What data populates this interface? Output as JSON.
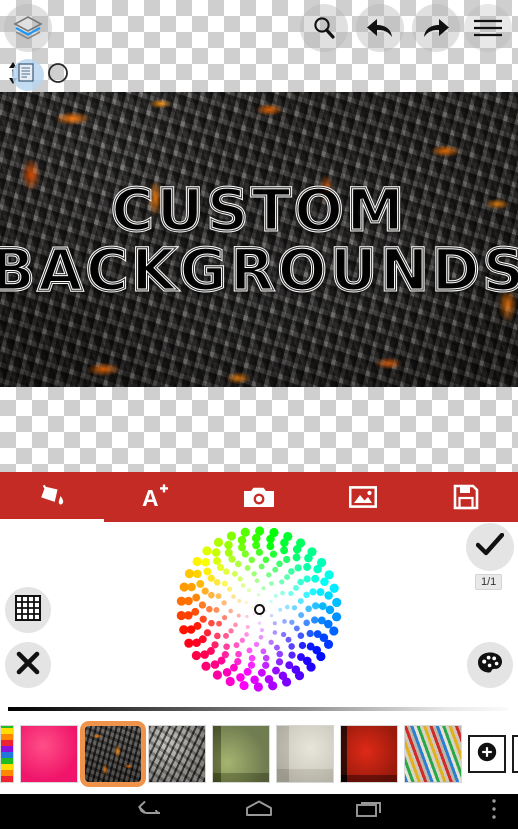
{
  "app": {
    "artwork_line_1": "CUSTOM",
    "artwork_line_2": "BACKGROUNDS"
  },
  "top_toolbar": {
    "items": [
      {
        "name": "layers-icon",
        "label": "Layers"
      },
      {
        "name": "search-icon",
        "label": "Zoom"
      },
      {
        "name": "undo-icon",
        "label": "Undo"
      },
      {
        "name": "redo-icon",
        "label": "Redo"
      },
      {
        "name": "hamburger-icon",
        "label": "Menu"
      }
    ]
  },
  "sub_toolbar": {
    "items": [
      {
        "name": "up-down-arrows-icon",
        "label": "Reorder"
      },
      {
        "name": "page-icon",
        "label": "Layer"
      },
      {
        "name": "circle-outline-icon",
        "label": "Opacity"
      }
    ]
  },
  "tabbar": {
    "tabs": [
      {
        "label": "Fill",
        "icon": "paint-bucket-icon",
        "active": true
      },
      {
        "label": "Text",
        "icon": "text-add-icon",
        "active": false
      },
      {
        "label": "Camera",
        "icon": "camera-icon",
        "active": false
      },
      {
        "label": "Gallery",
        "icon": "image-icon",
        "active": false
      },
      {
        "label": "Save",
        "icon": "save-icon",
        "active": false
      }
    ],
    "background_color": "#c42b24",
    "active_indicator_color": "#ffffff"
  },
  "picker": {
    "wheel_name": "color-wheel",
    "center_selector": "color-wheel-selector",
    "grid_button": "Pattern grid",
    "close_button": "Close",
    "palette_button": "Palette",
    "confirm_button": "Apply",
    "page_count": "1/1"
  },
  "thumbnails": {
    "items": [
      {
        "name": "thumb-rainbow",
        "texture": "tx-rainbow",
        "selected": false,
        "partial": true
      },
      {
        "name": "thumb-pink",
        "texture": "tx-pink",
        "selected": false,
        "partial": false
      },
      {
        "name": "thumb-lava",
        "texture": "tx-lava",
        "selected": true,
        "partial": false
      },
      {
        "name": "thumb-gray-rock",
        "texture": "tx-gray",
        "selected": false,
        "partial": false
      },
      {
        "name": "thumb-camo",
        "texture": "tx-camo",
        "selected": false,
        "partial": false
      },
      {
        "name": "thumb-beige",
        "texture": "tx-beige",
        "selected": false,
        "partial": false
      },
      {
        "name": "thumb-red-tech",
        "texture": "tx-redtech",
        "selected": false,
        "partial": false
      },
      {
        "name": "thumb-wires",
        "texture": "tx-wires",
        "selected": false,
        "partial": false
      }
    ],
    "add_button": "Add",
    "magic_button": "Effects",
    "selected_outline_color": "#f0934a"
  },
  "android_nav": {
    "back": "Back",
    "home": "Home",
    "recents": "Recent apps",
    "more": "More options"
  }
}
